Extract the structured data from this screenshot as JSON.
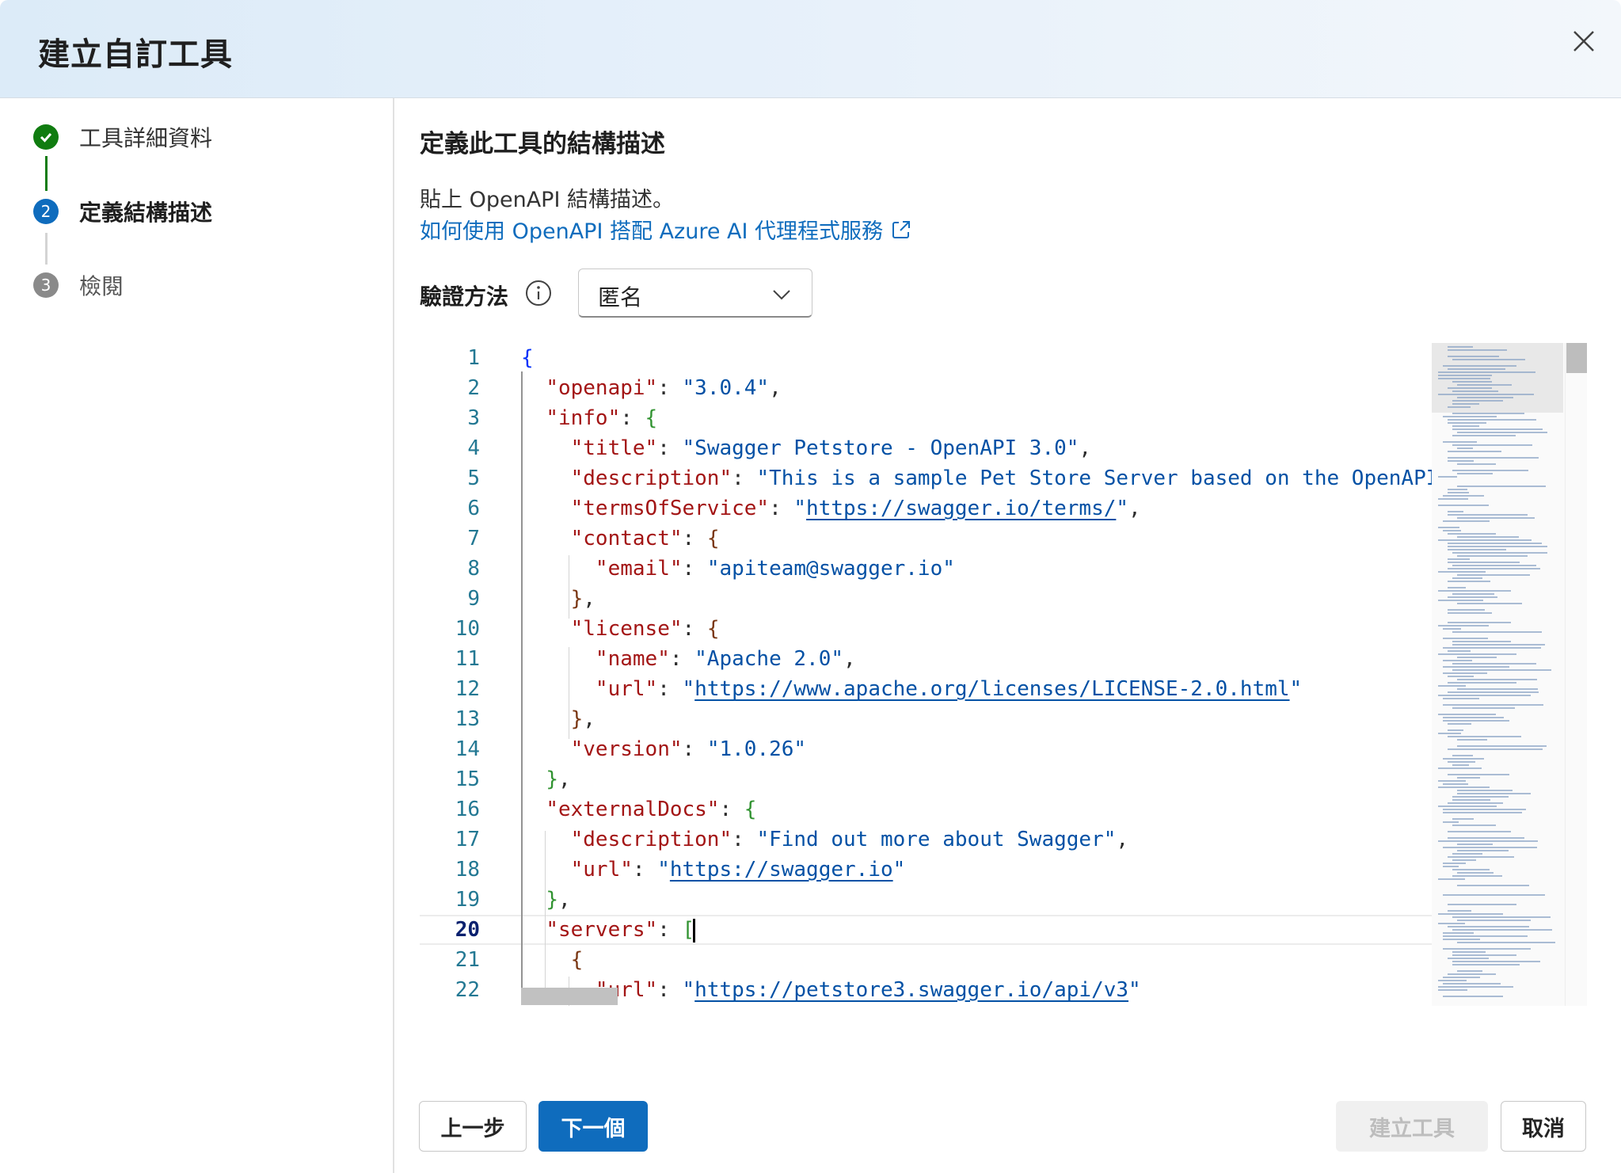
{
  "dialog": {
    "title": "建立自訂工具",
    "close_icon": "close-icon"
  },
  "steps": [
    {
      "number": "✓",
      "label": "工具詳細資料",
      "state": "completed"
    },
    {
      "number": "2",
      "label": "定義結構描述",
      "state": "current"
    },
    {
      "number": "3",
      "label": "檢閱",
      "state": "upcoming"
    }
  ],
  "main": {
    "heading": "定義此工具的結構描述",
    "description": "貼上 OpenAPI 結構描述。",
    "doc_link": "如何使用 OpenAPI 搭配 Azure AI 代理程式服務",
    "auth_label": "驗證方法",
    "auth_value": "匿名"
  },
  "editor": {
    "current_line": 20,
    "lines": [
      {
        "n": "1",
        "t": "{"
      },
      {
        "n": "2",
        "t": "  \"openapi\": \"3.0.4\","
      },
      {
        "n": "3",
        "t": "  \"info\": {"
      },
      {
        "n": "4",
        "t": "    \"title\": \"Swagger Petstore - OpenAPI 3.0\","
      },
      {
        "n": "5",
        "t": "    \"description\": \"This is a sample Pet Store Server based on the OpenAPI"
      },
      {
        "n": "6",
        "t": "    \"termsOfService\": \"https://swagger.io/terms/\","
      },
      {
        "n": "7",
        "t": "    \"contact\": {"
      },
      {
        "n": "8",
        "t": "      \"email\": \"apiteam@swagger.io\""
      },
      {
        "n": "9",
        "t": "    },"
      },
      {
        "n": "10",
        "t": "    \"license\": {"
      },
      {
        "n": "11",
        "t": "      \"name\": \"Apache 2.0\","
      },
      {
        "n": "12",
        "t": "      \"url\": \"https://www.apache.org/licenses/LICENSE-2.0.html\""
      },
      {
        "n": "13",
        "t": "    },"
      },
      {
        "n": "14",
        "t": "    \"version\": \"1.0.26\""
      },
      {
        "n": "15",
        "t": "  },"
      },
      {
        "n": "16",
        "t": "  \"externalDocs\": {"
      },
      {
        "n": "17",
        "t": "    \"description\": \"Find out more about Swagger\","
      },
      {
        "n": "18",
        "t": "    \"url\": \"https://swagger.io\""
      },
      {
        "n": "19",
        "t": "  },"
      },
      {
        "n": "20",
        "t": "  \"servers\": ["
      },
      {
        "n": "21",
        "t": "    {"
      },
      {
        "n": "22",
        "t": "      \"url\": \"https://petstore3.swagger.io/api/v3\""
      }
    ]
  },
  "footer": {
    "back": "上一步",
    "next": "下一個",
    "create": "建立工具",
    "cancel": "取消"
  },
  "colors": {
    "primary": "#0f6cbd",
    "success": "#107c10",
    "json_key": "#a31515",
    "json_string": "#0451a5"
  }
}
